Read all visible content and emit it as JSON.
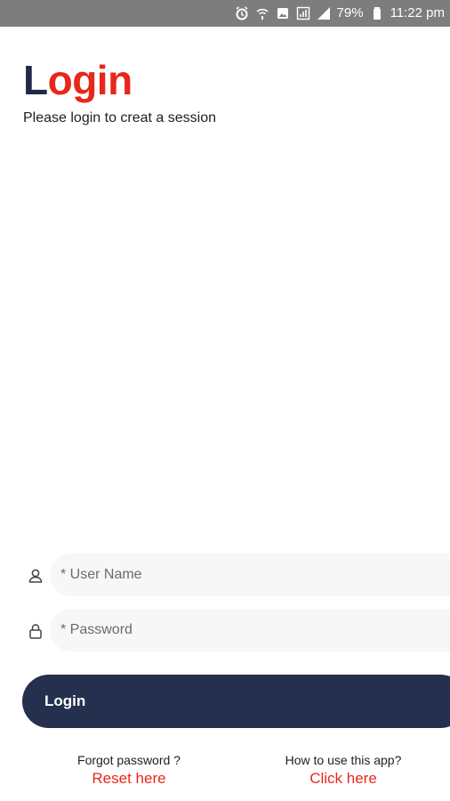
{
  "status_bar": {
    "battery": "79%",
    "time": "11:22 pm",
    "icons": [
      "alarm-icon",
      "wifi-icon",
      "photo-icon",
      "signal-box-icon",
      "signal-icon",
      "battery-icon"
    ]
  },
  "header": {
    "title_first": "L",
    "title_rest": "ogin",
    "subtitle": "Please login to creat a session"
  },
  "form": {
    "username_placeholder": "* User Name",
    "password_placeholder": "* Password",
    "login_label": "Login"
  },
  "help": {
    "forgot_label": "Forgot password ?",
    "reset_link": "Reset here",
    "howto_label": "How to use this app?",
    "click_link": "Click here"
  },
  "colors": {
    "accent": "#e8271b",
    "navy": "#25304e",
    "status_bar": "#7d7d7d"
  }
}
